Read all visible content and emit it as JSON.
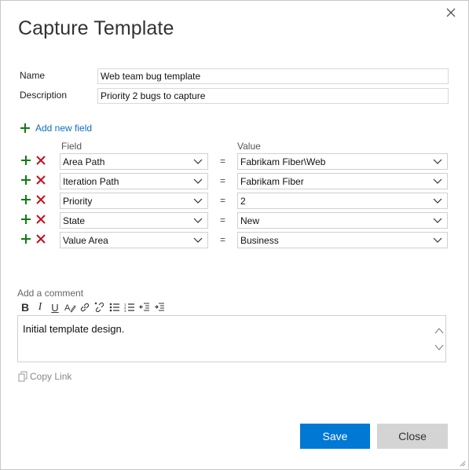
{
  "dialog": {
    "title": "Capture Template"
  },
  "form": {
    "name_label": "Name",
    "name_value": "Web team bug template",
    "description_label": "Description",
    "description_value": "Priority 2 bugs to capture"
  },
  "fields": {
    "add_label": "Add new field",
    "field_header": "Field",
    "value_header": "Value",
    "equals": "=",
    "rows": [
      {
        "field": "Area Path",
        "value": "Fabrikam Fiber\\Web"
      },
      {
        "field": "Iteration Path",
        "value": "Fabrikam Fiber"
      },
      {
        "field": "Priority",
        "value": "2"
      },
      {
        "field": "State",
        "value": "New"
      },
      {
        "field": "Value Area",
        "value": "Business"
      }
    ]
  },
  "comment": {
    "label": "Add a comment",
    "text": "Initial template design.",
    "toolbar": [
      "bold-icon",
      "italic-icon",
      "underline-icon",
      "highlight-icon",
      "link-icon",
      "unlink-icon",
      "bulleted-list-icon",
      "numbered-list-icon",
      "decrease-indent-icon",
      "increase-indent-icon"
    ]
  },
  "copy_link": "Copy Link",
  "buttons": {
    "save": "Save",
    "close": "Close"
  },
  "colors": {
    "accent": "#0078d4",
    "link": "#106ebe",
    "add_icon": "#107c10",
    "remove_icon": "#c50f1f"
  }
}
